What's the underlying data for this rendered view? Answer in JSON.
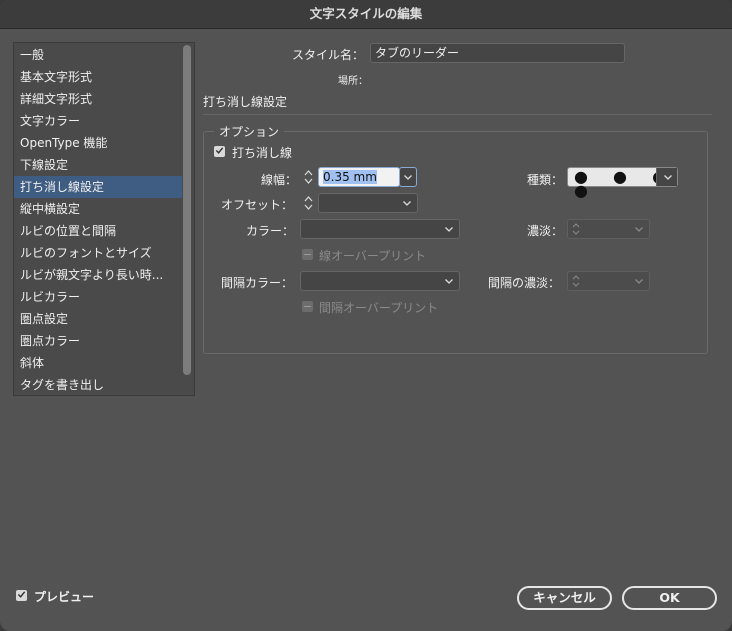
{
  "window": {
    "title": "文字スタイルの編集"
  },
  "sidebar": {
    "items": [
      {
        "label": "一般"
      },
      {
        "label": "基本文字形式"
      },
      {
        "label": "詳細文字形式"
      },
      {
        "label": "文字カラー"
      },
      {
        "label": "OpenType 機能"
      },
      {
        "label": "下線設定"
      },
      {
        "label": "打ち消し線設定",
        "selected": true
      },
      {
        "label": "縦中横設定"
      },
      {
        "label": "ルビの位置と間隔"
      },
      {
        "label": "ルビのフォントとサイズ"
      },
      {
        "label": "ルビが親文字より長い時..."
      },
      {
        "label": "ルビカラー"
      },
      {
        "label": "圏点設定"
      },
      {
        "label": "圏点カラー"
      },
      {
        "label": "斜体"
      },
      {
        "label": "タグを書き出し"
      }
    ]
  },
  "header": {
    "style_name_label": "スタイル名：",
    "style_name_value": "タブのリーダー",
    "location_label": "場所：",
    "section_title": "打ち消し線設定"
  },
  "options": {
    "group_label": "オプション",
    "strikethrough_on": {
      "label": "打ち消し線",
      "checked": true
    },
    "weight": {
      "label": "線幅：",
      "value": "0.35 mm"
    },
    "type": {
      "label": "種類：",
      "value": "● ● ● ●"
    },
    "offset": {
      "label": "オフセット：",
      "value": ""
    },
    "color": {
      "label": "カラー：",
      "value": ""
    },
    "tint": {
      "label": "濃淡：",
      "value": ""
    },
    "overprint_stroke": {
      "label": "線オーバープリント",
      "checked": false
    },
    "gap_color": {
      "label": "間隔カラー：",
      "value": ""
    },
    "gap_tint": {
      "label": "間隔の濃淡：",
      "value": ""
    },
    "overprint_gap": {
      "label": "間隔オーバープリント",
      "checked": false
    }
  },
  "footer": {
    "preview": {
      "label": "プレビュー",
      "checked": true
    },
    "cancel_label": "キャンセル",
    "ok_label": "OK"
  },
  "icons": [
    "chevron-down-icon",
    "stepper-icon",
    "checkmark-icon"
  ]
}
